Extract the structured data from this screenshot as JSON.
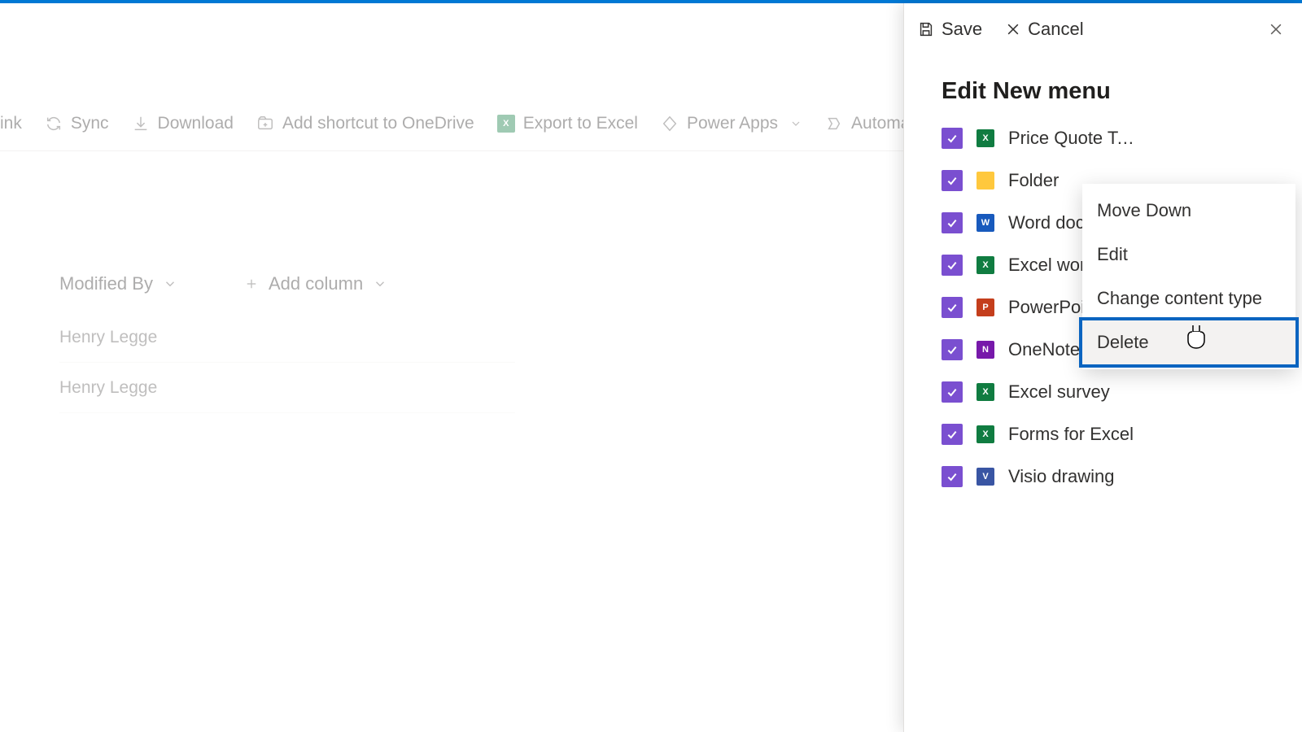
{
  "commandbar": {
    "link": "ink",
    "sync": "Sync",
    "download": "Download",
    "addShortcut": "Add shortcut to OneDrive",
    "exportExcel": "Export to Excel",
    "powerApps": "Power Apps",
    "automate": "Automate"
  },
  "columns": {
    "modifiedBy": "Modified By",
    "addColumn": "Add column"
  },
  "rows": [
    {
      "modifiedBy": "Henry Legge"
    },
    {
      "modifiedBy": "Henry Legge"
    }
  ],
  "panel": {
    "save": "Save",
    "cancel": "Cancel",
    "title": "Edit New menu",
    "items": [
      {
        "label": "Price Quote Templa…",
        "icon": "excel"
      },
      {
        "label": "Folder",
        "icon": "folder"
      },
      {
        "label": "Word document",
        "icon": "word"
      },
      {
        "label": "Excel workbook",
        "icon": "excel"
      },
      {
        "label": "PowerPoint presentation",
        "icon": "ppt"
      },
      {
        "label": "OneNote notebook",
        "icon": "one"
      },
      {
        "label": "Excel survey",
        "icon": "excel"
      },
      {
        "label": "Forms for Excel",
        "icon": "excel"
      },
      {
        "label": "Visio drawing",
        "icon": "visio"
      }
    ]
  },
  "contextMenu": {
    "items": [
      {
        "label": "Move Down"
      },
      {
        "label": "Edit"
      },
      {
        "label": "Change content type"
      },
      {
        "label": "Delete",
        "highlight": true
      }
    ]
  }
}
